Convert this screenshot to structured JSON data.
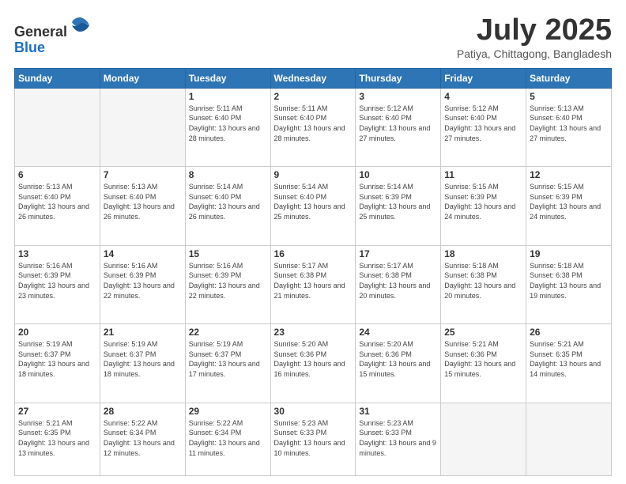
{
  "header": {
    "logo_line1": "General",
    "logo_line2": "Blue",
    "month_title": "July 2025",
    "subtitle": "Patiya, Chittagong, Bangladesh"
  },
  "weekdays": [
    "Sunday",
    "Monday",
    "Tuesday",
    "Wednesday",
    "Thursday",
    "Friday",
    "Saturday"
  ],
  "weeks": [
    [
      {
        "day": "",
        "sunrise": "",
        "sunset": "",
        "daylight": ""
      },
      {
        "day": "",
        "sunrise": "",
        "sunset": "",
        "daylight": ""
      },
      {
        "day": "1",
        "sunrise": "Sunrise: 5:11 AM",
        "sunset": "Sunset: 6:40 PM",
        "daylight": "Daylight: 13 hours and 28 minutes."
      },
      {
        "day": "2",
        "sunrise": "Sunrise: 5:11 AM",
        "sunset": "Sunset: 6:40 PM",
        "daylight": "Daylight: 13 hours and 28 minutes."
      },
      {
        "day": "3",
        "sunrise": "Sunrise: 5:12 AM",
        "sunset": "Sunset: 6:40 PM",
        "daylight": "Daylight: 13 hours and 27 minutes."
      },
      {
        "day": "4",
        "sunrise": "Sunrise: 5:12 AM",
        "sunset": "Sunset: 6:40 PM",
        "daylight": "Daylight: 13 hours and 27 minutes."
      },
      {
        "day": "5",
        "sunrise": "Sunrise: 5:13 AM",
        "sunset": "Sunset: 6:40 PM",
        "daylight": "Daylight: 13 hours and 27 minutes."
      }
    ],
    [
      {
        "day": "6",
        "sunrise": "Sunrise: 5:13 AM",
        "sunset": "Sunset: 6:40 PM",
        "daylight": "Daylight: 13 hours and 26 minutes."
      },
      {
        "day": "7",
        "sunrise": "Sunrise: 5:13 AM",
        "sunset": "Sunset: 6:40 PM",
        "daylight": "Daylight: 13 hours and 26 minutes."
      },
      {
        "day": "8",
        "sunrise": "Sunrise: 5:14 AM",
        "sunset": "Sunset: 6:40 PM",
        "daylight": "Daylight: 13 hours and 26 minutes."
      },
      {
        "day": "9",
        "sunrise": "Sunrise: 5:14 AM",
        "sunset": "Sunset: 6:40 PM",
        "daylight": "Daylight: 13 hours and 25 minutes."
      },
      {
        "day": "10",
        "sunrise": "Sunrise: 5:14 AM",
        "sunset": "Sunset: 6:39 PM",
        "daylight": "Daylight: 13 hours and 25 minutes."
      },
      {
        "day": "11",
        "sunrise": "Sunrise: 5:15 AM",
        "sunset": "Sunset: 6:39 PM",
        "daylight": "Daylight: 13 hours and 24 minutes."
      },
      {
        "day": "12",
        "sunrise": "Sunrise: 5:15 AM",
        "sunset": "Sunset: 6:39 PM",
        "daylight": "Daylight: 13 hours and 24 minutes."
      }
    ],
    [
      {
        "day": "13",
        "sunrise": "Sunrise: 5:16 AM",
        "sunset": "Sunset: 6:39 PM",
        "daylight": "Daylight: 13 hours and 23 minutes."
      },
      {
        "day": "14",
        "sunrise": "Sunrise: 5:16 AM",
        "sunset": "Sunset: 6:39 PM",
        "daylight": "Daylight: 13 hours and 22 minutes."
      },
      {
        "day": "15",
        "sunrise": "Sunrise: 5:16 AM",
        "sunset": "Sunset: 6:39 PM",
        "daylight": "Daylight: 13 hours and 22 minutes."
      },
      {
        "day": "16",
        "sunrise": "Sunrise: 5:17 AM",
        "sunset": "Sunset: 6:38 PM",
        "daylight": "Daylight: 13 hours and 21 minutes."
      },
      {
        "day": "17",
        "sunrise": "Sunrise: 5:17 AM",
        "sunset": "Sunset: 6:38 PM",
        "daylight": "Daylight: 13 hours and 20 minutes."
      },
      {
        "day": "18",
        "sunrise": "Sunrise: 5:18 AM",
        "sunset": "Sunset: 6:38 PM",
        "daylight": "Daylight: 13 hours and 20 minutes."
      },
      {
        "day": "19",
        "sunrise": "Sunrise: 5:18 AM",
        "sunset": "Sunset: 6:38 PM",
        "daylight": "Daylight: 13 hours and 19 minutes."
      }
    ],
    [
      {
        "day": "20",
        "sunrise": "Sunrise: 5:19 AM",
        "sunset": "Sunset: 6:37 PM",
        "daylight": "Daylight: 13 hours and 18 minutes."
      },
      {
        "day": "21",
        "sunrise": "Sunrise: 5:19 AM",
        "sunset": "Sunset: 6:37 PM",
        "daylight": "Daylight: 13 hours and 18 minutes."
      },
      {
        "day": "22",
        "sunrise": "Sunrise: 5:19 AM",
        "sunset": "Sunset: 6:37 PM",
        "daylight": "Daylight: 13 hours and 17 minutes."
      },
      {
        "day": "23",
        "sunrise": "Sunrise: 5:20 AM",
        "sunset": "Sunset: 6:36 PM",
        "daylight": "Daylight: 13 hours and 16 minutes."
      },
      {
        "day": "24",
        "sunrise": "Sunrise: 5:20 AM",
        "sunset": "Sunset: 6:36 PM",
        "daylight": "Daylight: 13 hours and 15 minutes."
      },
      {
        "day": "25",
        "sunrise": "Sunrise: 5:21 AM",
        "sunset": "Sunset: 6:36 PM",
        "daylight": "Daylight: 13 hours and 15 minutes."
      },
      {
        "day": "26",
        "sunrise": "Sunrise: 5:21 AM",
        "sunset": "Sunset: 6:35 PM",
        "daylight": "Daylight: 13 hours and 14 minutes."
      }
    ],
    [
      {
        "day": "27",
        "sunrise": "Sunrise: 5:21 AM",
        "sunset": "Sunset: 6:35 PM",
        "daylight": "Daylight: 13 hours and 13 minutes."
      },
      {
        "day": "28",
        "sunrise": "Sunrise: 5:22 AM",
        "sunset": "Sunset: 6:34 PM",
        "daylight": "Daylight: 13 hours and 12 minutes."
      },
      {
        "day": "29",
        "sunrise": "Sunrise: 5:22 AM",
        "sunset": "Sunset: 6:34 PM",
        "daylight": "Daylight: 13 hours and 11 minutes."
      },
      {
        "day": "30",
        "sunrise": "Sunrise: 5:23 AM",
        "sunset": "Sunset: 6:33 PM",
        "daylight": "Daylight: 13 hours and 10 minutes."
      },
      {
        "day": "31",
        "sunrise": "Sunrise: 5:23 AM",
        "sunset": "Sunset: 6:33 PM",
        "daylight": "Daylight: 13 hours and 9 minutes."
      },
      {
        "day": "",
        "sunrise": "",
        "sunset": "",
        "daylight": ""
      },
      {
        "day": "",
        "sunrise": "",
        "sunset": "",
        "daylight": ""
      }
    ]
  ]
}
